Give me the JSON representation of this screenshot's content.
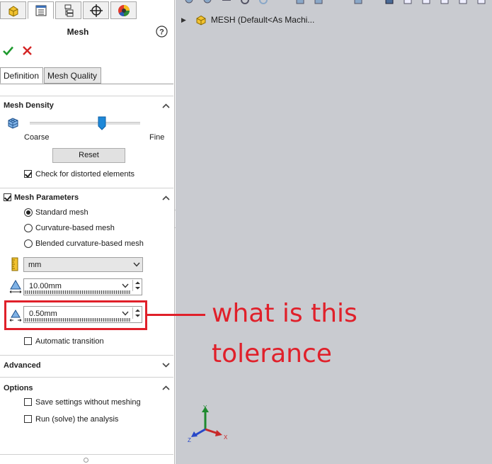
{
  "panel": {
    "icon_tabs": [
      {
        "icon": "feature-manager-icon",
        "active": false
      },
      {
        "icon": "property-manager-icon",
        "active": true
      },
      {
        "icon": "configuration-manager-icon",
        "active": false
      },
      {
        "icon": "dimxpert-icon",
        "active": false
      },
      {
        "icon": "display-manager-icon",
        "active": false
      }
    ],
    "title": "Mesh",
    "tabs": [
      "Definition",
      "Mesh Quality"
    ],
    "mesh_density": {
      "title": "Mesh Density",
      "coarse_label": "Coarse",
      "fine_label": "Fine",
      "slider_level": 0.65,
      "reset_label": "Reset",
      "check_distorted_label": "Check for distorted elements",
      "check_distorted_checked": true
    },
    "mesh_parameters": {
      "title": "Mesh Parameters",
      "enabled": true,
      "options": [
        {
          "label": "Standard mesh",
          "selected": true
        },
        {
          "label": "Curvature-based mesh",
          "selected": false
        },
        {
          "label": "Blended curvature-based mesh",
          "selected": false
        }
      ],
      "unit": "mm",
      "element_size": "10.00mm",
      "tolerance": "0.50mm",
      "auto_transition_label": "Automatic transition",
      "auto_transition_checked": false
    },
    "advanced": {
      "title": "Advanced"
    },
    "options": {
      "title": "Options",
      "save_without_meshing_label": "Save settings without meshing",
      "save_without_meshing_checked": false,
      "run_analysis_label": "Run (solve) the analysis",
      "run_analysis_checked": false
    }
  },
  "graphics": {
    "tree_label": "MESH  (Default<As Machi..."
  },
  "annotation": {
    "text_line1": "what is this",
    "text_line2": "tolerance",
    "color": "#e0202a"
  },
  "triad": {
    "x": "X",
    "y": "Y",
    "z": "Z"
  }
}
